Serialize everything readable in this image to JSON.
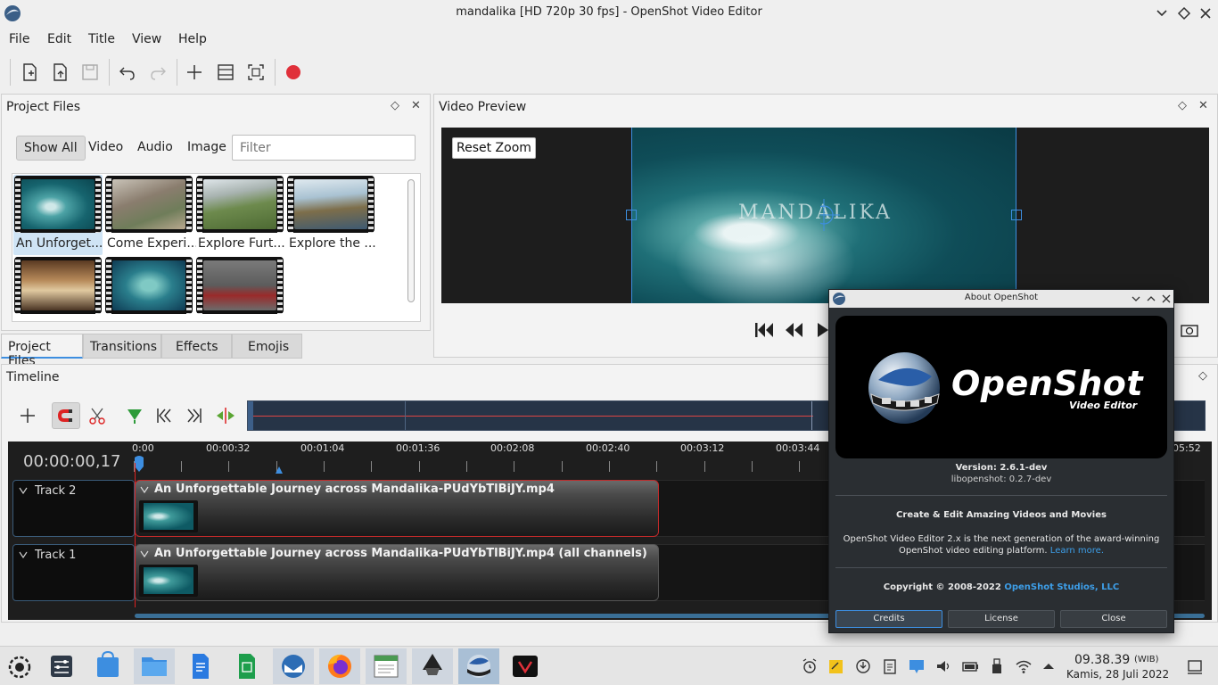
{
  "window": {
    "title": "mandalika [HD 720p 30 fps] - OpenShot Video Editor"
  },
  "menu": [
    "File",
    "Edit",
    "Title",
    "View",
    "Help"
  ],
  "project_files": {
    "title": "Project Files",
    "filters": [
      "Show All",
      "Video",
      "Audio",
      "Image"
    ],
    "filter_placeholder": "Filter",
    "items": [
      {
        "label": "An Unforget..."
      },
      {
        "label": "Come Experi..."
      },
      {
        "label": "Explore Furt..."
      },
      {
        "label": "Explore the ..."
      },
      {
        "label": ""
      },
      {
        "label": ""
      },
      {
        "label": ""
      }
    ]
  },
  "tabs": [
    "Project Files",
    "Transitions",
    "Effects",
    "Emojis"
  ],
  "video_preview": {
    "title": "Video Preview",
    "reset_zoom": "Reset Zoom",
    "watermark": "MANDALIKA"
  },
  "timeline": {
    "title": "Timeline",
    "current_time": "00:00:00,17",
    "ticks": [
      "0:00",
      "00:00:32",
      "00:01:04",
      "00:01:36",
      "00:02:08",
      "00:02:40",
      "00:03:12",
      "00:03:44",
      "05:52"
    ],
    "tracks": [
      {
        "name": "Track 2",
        "clip": "An Unforgettable Journey across Mandalika-PUdYbTlBiJY.mp4"
      },
      {
        "name": "Track 1",
        "clip": "An Unforgettable Journey across Mandalika-PUdYbTlBiJY.mp4 (all channels)"
      }
    ]
  },
  "about": {
    "window_title": "About OpenShot",
    "logo_text": "OpenShot",
    "logo_sub": "Video Editor",
    "version": "Version: 2.6.1-dev",
    "libopenshot": "libopenshot: 0.2.7-dev",
    "heading": "Create & Edit Amazing Videos and Movies",
    "desc_line1": "OpenShot Video Editor 2.x is the next generation of the award-winning",
    "desc_line2": "OpenShot video editing platform.",
    "learn_more": "Learn more.",
    "copyright": "Copyright © 2008-2022",
    "studio": "OpenShot Studios, LLC",
    "buttons": [
      "Credits",
      "License",
      "Close"
    ]
  },
  "taskbar": {
    "time": "09.38.39",
    "tz": "(WIB)",
    "date": "Kamis, 28 Juli 2022"
  },
  "colors": {
    "accent": "#3d8ee0",
    "record": "#e0303a",
    "clip_selected": "#c02a2a",
    "link": "#3d9ee8"
  }
}
